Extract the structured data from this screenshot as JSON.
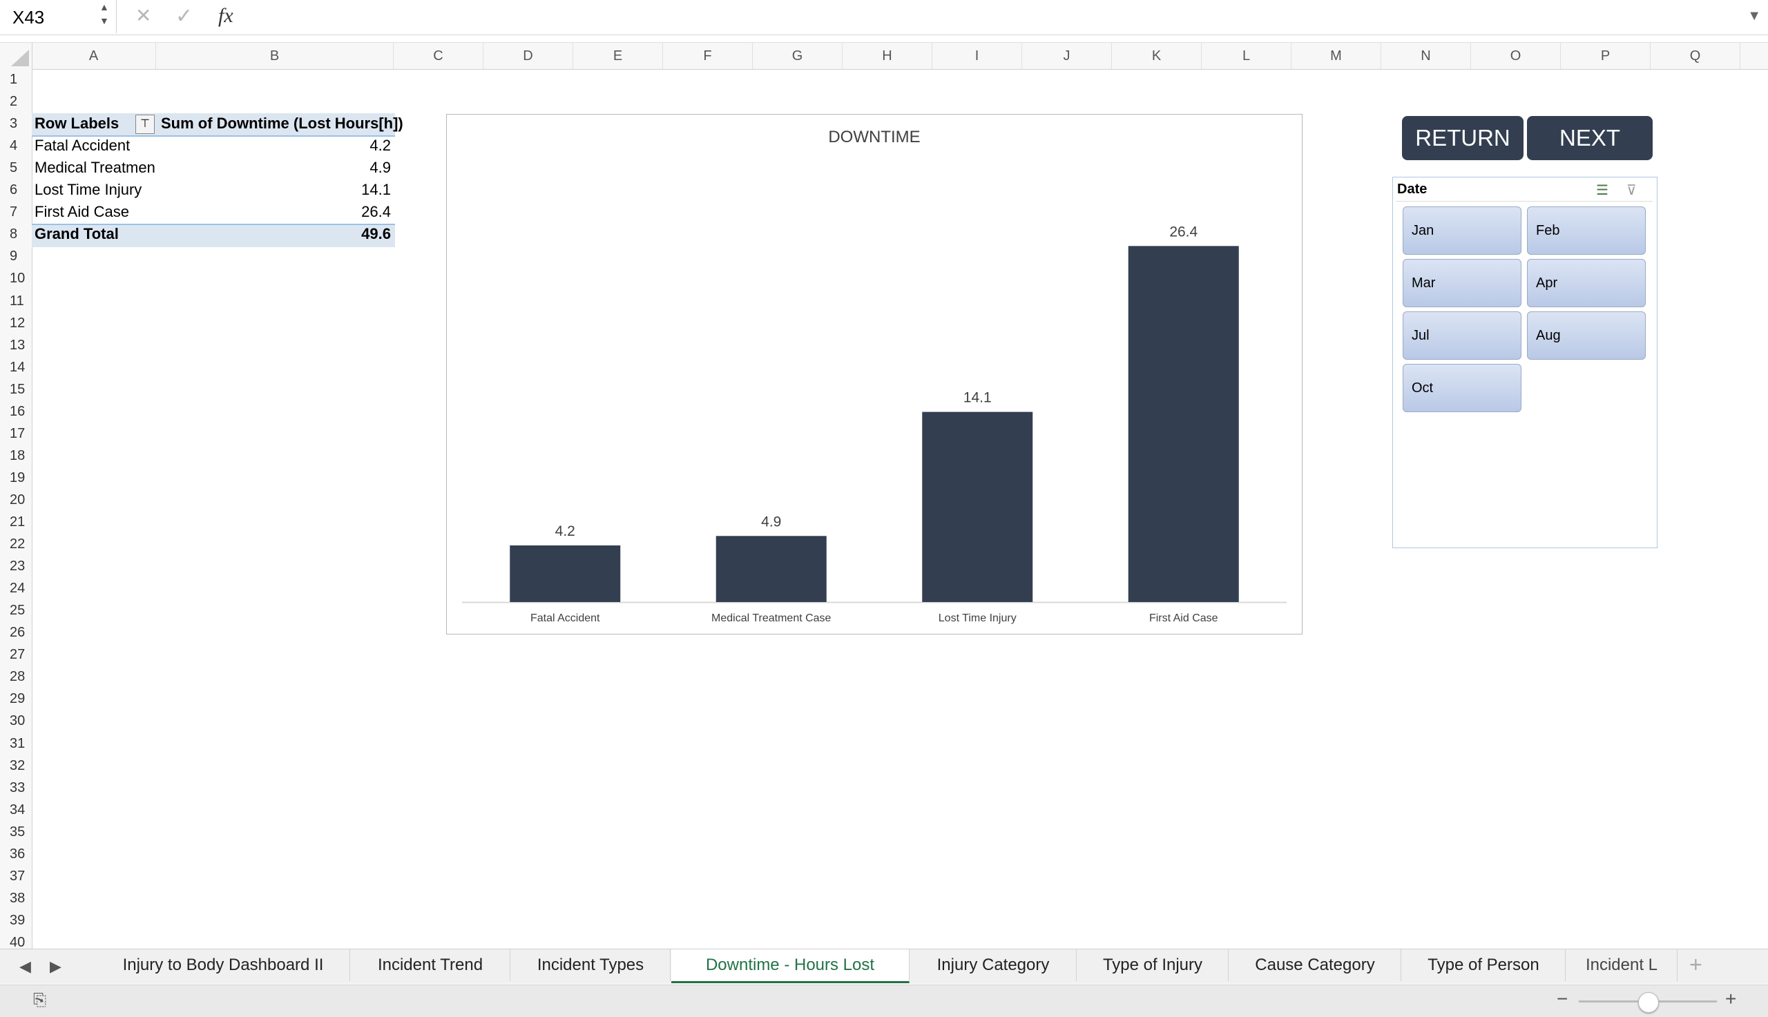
{
  "formula_bar": {
    "name_box": "X43",
    "cancel_icon": "✕",
    "enter_icon": "✓",
    "fx_label": "fx",
    "formula": ""
  },
  "columns": [
    "A",
    "B",
    "C",
    "D",
    "E",
    "F",
    "G",
    "H",
    "I",
    "J",
    "K",
    "L",
    "M",
    "N",
    "O",
    "P",
    "Q"
  ],
  "rows": [
    "1",
    "2",
    "3",
    "4",
    "5",
    "6",
    "7",
    "8",
    "9",
    "10",
    "11",
    "12",
    "13",
    "14",
    "15",
    "16",
    "17",
    "18",
    "19",
    "20",
    "21",
    "22",
    "23",
    "24",
    "25",
    "26",
    "27",
    "28",
    "29",
    "30",
    "31",
    "32",
    "33",
    "34",
    "35",
    "36",
    "37",
    "38",
    "39",
    "40"
  ],
  "pivot": {
    "header_label": "Row Labels",
    "header_value": "Sum of Downtime (Lost Hours[h])",
    "rows": [
      {
        "label": "Fatal Accident",
        "value": "4.2"
      },
      {
        "label": "Medical Treatmen",
        "value": "4.9"
      },
      {
        "label": "Lost Time Injury",
        "value": "14.1"
      },
      {
        "label": "First Aid Case",
        "value": "26.4"
      }
    ],
    "total_label": "Grand Total",
    "total_value": "49.6"
  },
  "chart_data": {
    "type": "bar",
    "title": "DOWNTIME",
    "categories": [
      "Fatal Accident",
      "Medical Treatment Case",
      "Lost Time Injury",
      "First Aid Case"
    ],
    "values": [
      4.2,
      4.9,
      14.1,
      26.4
    ],
    "ylim": [
      0,
      30
    ],
    "xlabel": "",
    "ylabel": "",
    "grid": false,
    "bar_color": "#333f50"
  },
  "buttons": {
    "return": "RETURN",
    "next": "NEXT"
  },
  "slicer": {
    "title": "Date",
    "items": [
      "Jan",
      "Feb",
      "Mar",
      "Apr",
      "Jul",
      "Aug",
      "Oct"
    ]
  },
  "sheet_tabs": [
    {
      "label": "Injury to Body Dashboard II"
    },
    {
      "label": "Incident Trend"
    },
    {
      "label": "Incident Types"
    },
    {
      "label": "Downtime - Hours Lost",
      "active": true
    },
    {
      "label": "Injury Category"
    },
    {
      "label": "Type of Injury"
    },
    {
      "label": "Cause Category"
    },
    {
      "label": "Type of Person"
    },
    {
      "label": "Incident L"
    }
  ],
  "add_sheet": "+",
  "zoom_minus": "−",
  "zoom_plus": "+",
  "colors": {
    "accent": "#217346",
    "bar": "#333f50",
    "pivot_header": "#dce6f1"
  }
}
